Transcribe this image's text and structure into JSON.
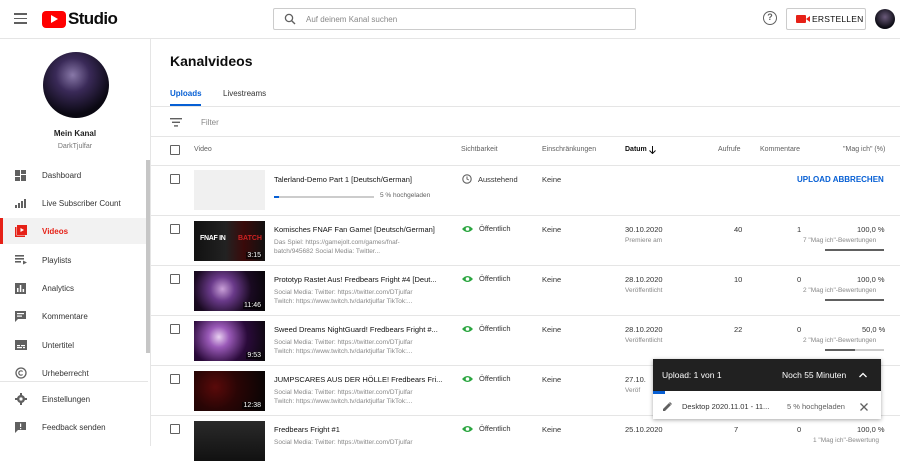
{
  "header": {
    "logo_text": "Studio",
    "search_placeholder": "Auf deinem Kanal suchen",
    "create_label": "ERSTELLEN"
  },
  "sidebar": {
    "channel_name": "Mein Kanal",
    "channel_handle": "DarkTjulfar",
    "items": [
      {
        "label": "Dashboard",
        "icon": "dashboard-icon"
      },
      {
        "label": "Live Subscriber Count",
        "icon": "signal-icon"
      },
      {
        "label": "Videos",
        "icon": "videos-icon",
        "active": true
      },
      {
        "label": "Playlists",
        "icon": "playlists-icon"
      },
      {
        "label": "Analytics",
        "icon": "analytics-icon"
      },
      {
        "label": "Kommentare",
        "icon": "comments-icon"
      },
      {
        "label": "Untertitel",
        "icon": "subtitles-icon"
      },
      {
        "label": "Urheberrecht",
        "icon": "copyright-icon"
      },
      {
        "label": "Einstellungen",
        "icon": "gear-icon"
      },
      {
        "label": "Feedback senden",
        "icon": "feedback-icon"
      }
    ]
  },
  "main": {
    "title": "Kanalvideos",
    "tabs": [
      "Uploads",
      "Livestreams"
    ],
    "filter_placeholder": "Filter",
    "columns": {
      "video": "Video",
      "visibility": "Sichtbarkeit",
      "restrictions": "Einschränkungen",
      "date": "Datum",
      "views": "Aufrufe",
      "comments": "Kommentare",
      "likes": "\"Mag ich\" (%)"
    },
    "uploading_row": {
      "title": "Talerland-Demo Part 1 [Deutsch/German]",
      "progress_text": "5 % hochgeladen",
      "progress": 0.05,
      "visibility": "Ausstehend",
      "restrictions": "Keine",
      "action": "UPLOAD ABBRECHEN"
    },
    "videos": [
      {
        "title": "Komisches FNAF Fan Game! [Deutsch/German]",
        "desc1": "Das Spiel: https://gamejolt.com/games/fnaf-",
        "desc2": "batch/945682 Social Media: Twitter...",
        "duration": "3:15",
        "visibility": "Öffentlich",
        "restrictions": "Keine",
        "date": "30.10.2020",
        "date_status": "Premiere am",
        "views": "40",
        "comments": "1",
        "likes_pct": "100,0 %",
        "likes_text": "7 \"Mag ich\"-Bewertungen",
        "likes_ratio": 1.0
      },
      {
        "title": "Prototyp Rastet Aus! Fredbears Fright #4 [Deut...",
        "desc1": "Social Media: Twitter: https://twitter.com/DTjulfar",
        "desc2": "Twitch: https://www.twitch.tv/darktjulfar TikTok:...",
        "duration": "11:46",
        "visibility": "Öffentlich",
        "restrictions": "Keine",
        "date": "28.10.2020",
        "date_status": "Veröffentlicht",
        "views": "10",
        "comments": "0",
        "likes_pct": "100,0 %",
        "likes_text": "2 \"Mag ich\"-Bewertungen",
        "likes_ratio": 1.0
      },
      {
        "title": "Sweed Dreams NightGuard! Fredbears Fright #...",
        "desc1": "Social Media: Twitter: https://twitter.com/DTjulfar",
        "desc2": "Twitch: https://www.twitch.tv/darktjulfar TikTok:...",
        "duration": "9:53",
        "visibility": "Öffentlich",
        "restrictions": "Keine",
        "date": "28.10.2020",
        "date_status": "Veröffentlicht",
        "views": "22",
        "comments": "0",
        "likes_pct": "50,0 %",
        "likes_text": "2 \"Mag ich\"-Bewertungen",
        "likes_ratio": 0.5
      },
      {
        "title": "JUMPSCARES AUS DER HÖLLE! Fredbears Fri...",
        "desc1": "Social Media: Twitter: https://twitter.com/DTjulfar",
        "desc2": "Twitch: https://www.twitch.tv/darktjulfar TikTok:...",
        "duration": "12:38",
        "visibility": "Öffentlich",
        "restrictions": "Keine",
        "date": "27.10.",
        "date_status": "Veröf",
        "views": "",
        "comments": "",
        "likes_pct": "",
        "likes_text": "",
        "likes_ratio": 0
      },
      {
        "title": "Fredbears Fright #1",
        "desc1": "Social Media: Twitter: https://twitter.com/DTjulfar",
        "desc2": "",
        "duration": "",
        "visibility": "Öffentlich",
        "restrictions": "Keine",
        "date": "25.10.2020",
        "date_status": "",
        "views": "7",
        "comments": "0",
        "likes_pct": "100,0 %",
        "likes_text": "1 \"Mag ich\"-Bewertung",
        "likes_ratio": 1.0
      }
    ]
  },
  "upload_panel": {
    "title": "Upload: 1 von 1",
    "remaining": "Noch 55 Minuten",
    "file": "Desktop 2020.11.01 - 11...",
    "status": "5 % hochgeladen",
    "progress": 0.05
  },
  "colors": {
    "accent": "#065fd4",
    "brand": "#ff0000",
    "active_nav": "#e62117",
    "visible_green": "#2ba640"
  }
}
